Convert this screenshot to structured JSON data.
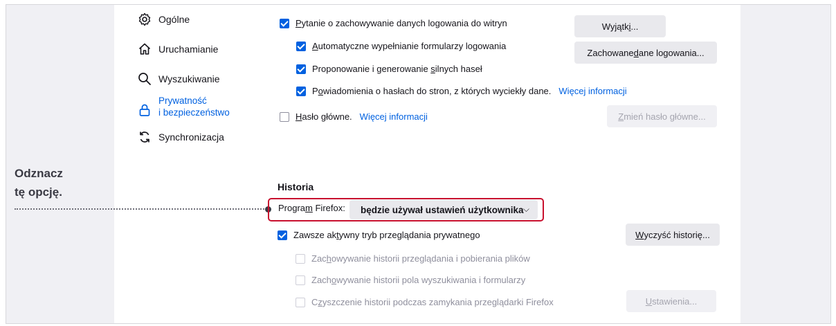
{
  "sidebar": {
    "items": [
      {
        "label": "Ogólne",
        "icon": "gear-icon"
      },
      {
        "label": "Uruchamianie",
        "icon": "home-icon"
      },
      {
        "label": "Wyszukiwanie",
        "icon": "search-icon"
      },
      {
        "label_line1": "Prywatność",
        "label_line2": "i bezpieczeństwo",
        "icon": "lock-icon",
        "active": true
      },
      {
        "label": "Synchronizacja",
        "icon": "sync-icon"
      }
    ]
  },
  "logins": {
    "ask_save": {
      "pre": "",
      "u": "P",
      "post": "ytanie o zachowywanie danych logowania do witryn",
      "checked": true
    },
    "autofill": {
      "pre": "",
      "u": "A",
      "post": "utomatyczne wypełnianie formularzy logowania",
      "checked": true
    },
    "suggest": {
      "pre": "Proponowanie i generowanie ",
      "u": "s",
      "post": "ilnych haseł",
      "checked": true
    },
    "breach": {
      "pre": "P",
      "u": "o",
      "post": "wiadomienia o hasłach do stron, z których wyciekły dane.",
      "link": "Więcej informacji",
      "checked": true
    },
    "master": {
      "pre": "",
      "u": "H",
      "post": "asło główne.",
      "link": "Więcej informacji",
      "checked": false
    },
    "exceptions_button": {
      "pre": "Wyjątk",
      "u": "i",
      "post": "..."
    },
    "saved_logins_button": {
      "pre": "Zachowane ",
      "u": "d",
      "post": "ane logowania..."
    },
    "change_master_button": {
      "pre": "",
      "u": "Z",
      "post": "mień hasło główne..."
    }
  },
  "history": {
    "title": "Historia",
    "program_label": {
      "pre": "Progra",
      "u": "m",
      "post": " Firefox:"
    },
    "mode_value": "będzie używał ustawień użytkownika",
    "chevron": "⌵",
    "private_mode": {
      "pre": "Zawsze ak",
      "u": "t",
      "post": "ywny tryb przeglądania prywatnego",
      "checked": true
    },
    "clear_button": {
      "pre": "",
      "u": "W",
      "post": "yczyść historię..."
    },
    "remember_browsing": {
      "pre": "Zac",
      "u": "h",
      "post": "owywanie historii przeglądania i pobierania plików",
      "checked": false
    },
    "remember_search": {
      "pre": "Zach",
      "u": "o",
      "post": "wywanie historii pola wyszukiwania i formularzy",
      "checked": false
    },
    "clear_on_close": {
      "pre": "C",
      "u": "z",
      "post": "yszczenie historii podczas zamykania przeglądarki Firefox",
      "checked": false
    },
    "settings_button": {
      "pre": "",
      "u": "U",
      "post": "stawienia..."
    }
  },
  "callout": {
    "line1": "Odznacz",
    "line2": "tę opcję."
  },
  "colors": {
    "accent": "#0061e0",
    "highlight": "#c8102e",
    "panel_bg": "#ffffff",
    "page_bg": "#f0f0f4"
  }
}
